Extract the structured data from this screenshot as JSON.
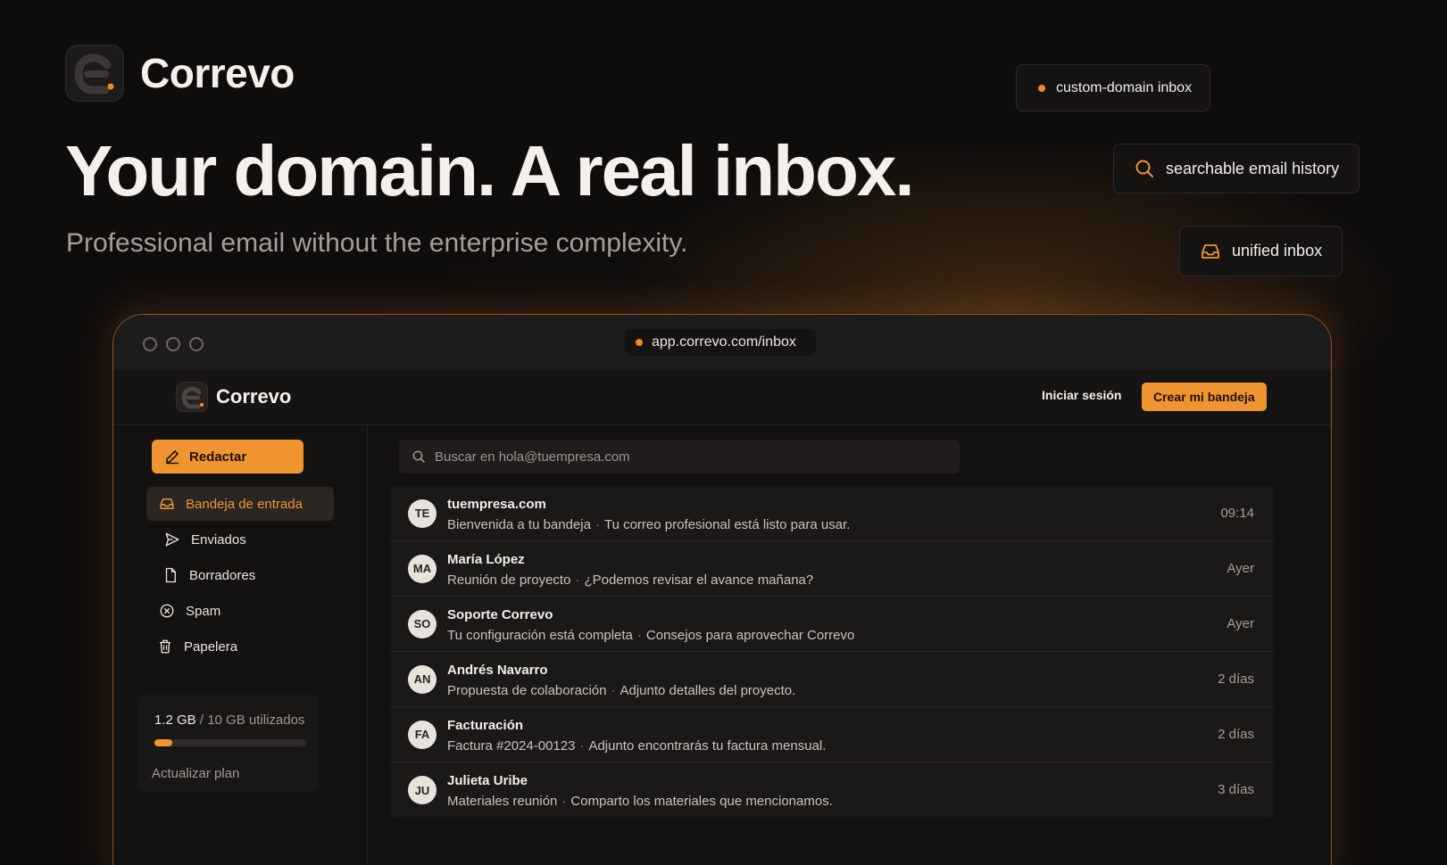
{
  "brand": {
    "name": "Correvo"
  },
  "hero": {
    "title": "Your domain. A real inbox.",
    "subtitle": "Professional email without the enterprise complexity."
  },
  "features": [
    {
      "label": "custom-domain inbox",
      "icon": "orange-dot-icon"
    },
    {
      "label": "searchable email history",
      "icon": "search-icon"
    },
    {
      "label": "unified inbox",
      "icon": "inbox-icon"
    }
  ],
  "browser": {
    "url": "app.correvo.com/inbox"
  },
  "app": {
    "brand_name": "Correvo",
    "login_label": "Iniciar sesión",
    "create_label": "Crear mi bandeja",
    "compose_label": "Redactar",
    "nav": [
      {
        "label": "Bandeja de entrada",
        "icon": "inbox-icon",
        "active": true
      },
      {
        "label": "Enviados",
        "icon": "send-icon",
        "active": false
      },
      {
        "label": "Borradores",
        "icon": "file-icon",
        "active": false
      },
      {
        "label": "Spam",
        "icon": "x-circle-icon",
        "active": false
      },
      {
        "label": "Papelera",
        "icon": "trash-icon",
        "active": false
      }
    ],
    "storage": {
      "used": "1.2 GB",
      "total": "/ 10 GB utilizados",
      "fraction_used": 0.12,
      "upgrade_label": "Actualizar plan"
    },
    "search_placeholder": "Buscar en hola@tuempresa.com",
    "emails": [
      {
        "initials": "TE",
        "from": "tuempresa.com",
        "subject": "Bienvenida a tu bandeja",
        "preview": "Tu correo profesional está listo para usar.",
        "time": "09:14"
      },
      {
        "initials": "MA",
        "from": "María López",
        "subject": "Reunión de proyecto",
        "preview": "¿Podemos revisar el avance mañana?",
        "time": "Ayer"
      },
      {
        "initials": "SO",
        "from": "Soporte Correvo",
        "subject": "Tu configuración está completa",
        "preview": "Consejos para aprovechar Correvo",
        "time": "Ayer"
      },
      {
        "initials": "AN",
        "from": "Andrés Navarro",
        "subject": "Propuesta de colaboración",
        "preview": "Adjunto detalles del proyecto.",
        "time": "2 días"
      },
      {
        "initials": "FA",
        "from": "Facturación",
        "subject": "Factura #2024-00123",
        "preview": "Adjunto encontrarás tu factura mensual.",
        "time": "2 días"
      },
      {
        "initials": "JU",
        "from": "Julieta Uribe",
        "subject": "Materiales reunión",
        "preview": "Comparto los materiales que mencionamos.",
        "time": "3 días"
      }
    ],
    "separator": "·"
  },
  "colors": {
    "accent": "#f0942f",
    "background": "#0f0d0c"
  }
}
